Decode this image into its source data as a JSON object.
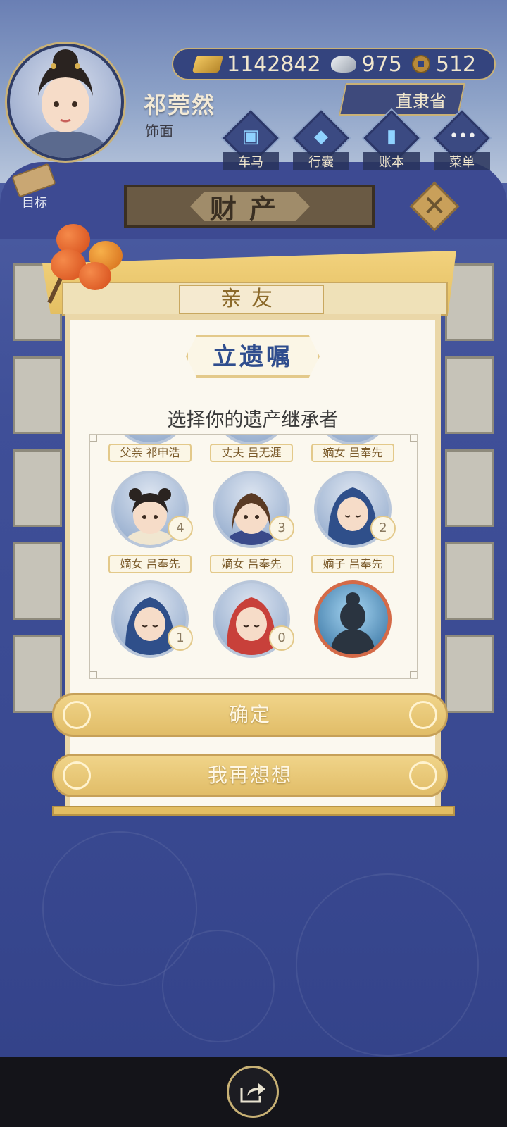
{
  "header": {
    "player_name": "祁莞然",
    "player_title": "饰面",
    "currency": {
      "gold": "1142842",
      "silver": "975",
      "copper": "512"
    },
    "location": "直隶省",
    "nav": [
      {
        "label": "车马",
        "icon": "carriage-icon"
      },
      {
        "label": "行囊",
        "icon": "bag-icon"
      },
      {
        "label": "账本",
        "icon": "ledger-icon"
      },
      {
        "label": "菜单",
        "icon": "menu-icon"
      }
    ],
    "goal_label": "目标"
  },
  "property_banner": "财产",
  "dialog": {
    "tab": "亲友",
    "title": "立遗嘱",
    "prompt": "选择你的遗产继承者",
    "heirs_row1_labels": [
      "父亲 祁申浩",
      "丈夫 吕无涯",
      "嫡女 吕奉先"
    ],
    "heirs_row2": [
      {
        "badge": "4",
        "type": "girl-buns"
      },
      {
        "badge": "3",
        "type": "girl-long"
      },
      {
        "badge": "2",
        "type": "baby-blue"
      }
    ],
    "heirs_row2_labels": [
      "嫡女 吕奉先",
      "嫡女 吕奉先",
      "嫡子 吕奉先"
    ],
    "heirs_row3": [
      {
        "badge": "1",
        "type": "baby-blue"
      },
      {
        "badge": "0",
        "type": "baby-red"
      },
      {
        "badge": "",
        "type": "silhouette"
      }
    ],
    "confirm": "确定",
    "reconsider": "我再想想"
  },
  "colors": {
    "accent_gold": "#e1bd68",
    "title_blue": "#2f4d8e",
    "bg_blue": "#3b4a8e"
  }
}
